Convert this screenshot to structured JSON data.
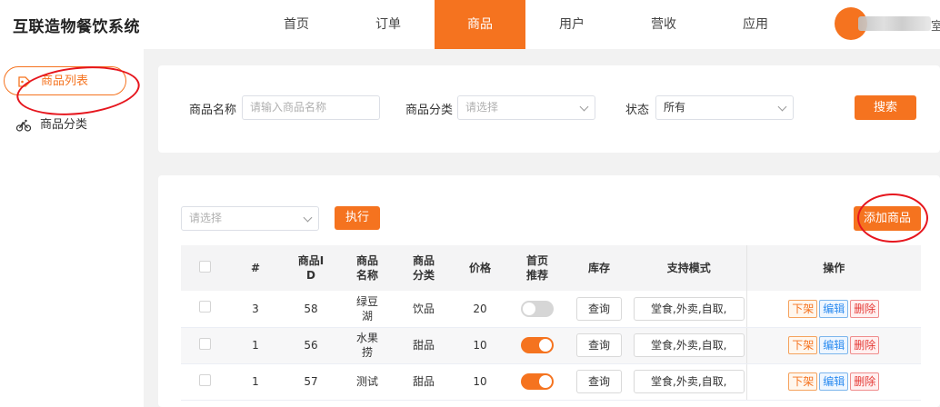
{
  "app": {
    "title": "互联造物餐饮系统"
  },
  "nav": {
    "items": [
      {
        "label": "首页",
        "active": false
      },
      {
        "label": "订单",
        "active": false
      },
      {
        "label": "商品",
        "active": true
      },
      {
        "label": "用户",
        "active": false
      },
      {
        "label": "营收",
        "active": false
      },
      {
        "label": "应用",
        "active": false
      }
    ],
    "user_tail": "室"
  },
  "sidebar": {
    "items": [
      {
        "label": "商品列表",
        "icon": "tag-icon",
        "active": true
      },
      {
        "label": "商品分类",
        "icon": "bicycle-icon",
        "active": false
      }
    ]
  },
  "search": {
    "name_label": "商品名称",
    "name_placeholder": "请输入商品名称",
    "category_label": "商品分类",
    "category_placeholder": "请选择",
    "status_label": "状态",
    "status_value": "所有",
    "search_button": "搜索"
  },
  "toolbar": {
    "batch_placeholder": "请选择",
    "execute_button": "执行",
    "add_button": "添加商品"
  },
  "table": {
    "headers": [
      "#",
      "商品ID",
      "商品名称",
      "商品分类",
      "价格",
      "首页推荐",
      "库存",
      "支持模式",
      "操作"
    ],
    "header_lines": {
      "id": [
        "商品I",
        "D"
      ],
      "name": [
        "商品",
        "名称"
      ],
      "category": [
        "商品",
        "分类"
      ],
      "recommend": [
        "首页",
        "推荐"
      ]
    },
    "rows": [
      {
        "index": "3",
        "id": "58",
        "name_lines": [
          "绿豆",
          "湖"
        ],
        "category": "饮品",
        "price": "20",
        "recommended": false,
        "stock_button": "查询",
        "modes": "堂食,外卖,自取,",
        "actions": [
          "下架",
          "编辑",
          "删除"
        ]
      },
      {
        "index": "1",
        "id": "56",
        "name_lines": [
          "水果",
          "捞"
        ],
        "category": "甜品",
        "price": "10",
        "recommended": true,
        "stock_button": "查询",
        "modes": "堂食,外卖,自取,",
        "actions": [
          "下架",
          "编辑",
          "删除"
        ]
      },
      {
        "index": "1",
        "id": "57",
        "name_lines": [
          "测试"
        ],
        "category": "甜品",
        "price": "10",
        "recommended": true,
        "stock_button": "查询",
        "modes": "堂食,外卖,自取,",
        "actions": [
          "下架",
          "编辑",
          "删除"
        ]
      }
    ]
  },
  "colors": {
    "accent": "#f5731f",
    "annotation": "#e6161e",
    "edit": "#2d8cf0",
    "delete": "#e53935"
  }
}
